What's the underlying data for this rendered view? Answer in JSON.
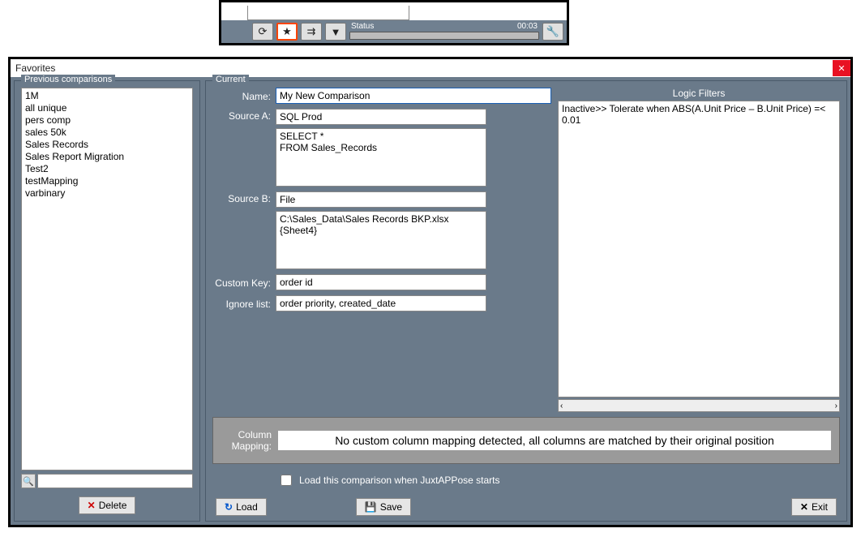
{
  "toolbar": {
    "refresh": "⟳",
    "star": "★",
    "map": "⇉",
    "filter": "▼",
    "status_label": "Status",
    "time": "00:03",
    "wrench": "🔧"
  },
  "dialog": {
    "title": "Favorites",
    "close": "✕"
  },
  "previous": {
    "group_title": "Previous comparisons",
    "items": [
      "1M",
      "all unique",
      "pers comp",
      "sales 50k",
      "Sales Records",
      "Sales Report Migration",
      "Test2",
      "testMapping",
      "varbinary"
    ],
    "search_icon": "🔍",
    "delete_icon": "✕",
    "delete_label": "Delete"
  },
  "current": {
    "group_title": "Current",
    "labels": {
      "name": "Name:",
      "sourceA": "Source A:",
      "sourceB": "Source B:",
      "customKey": "Custom Key:",
      "ignoreList": "Ignore list:",
      "columnMapping": "Column\nMapping:"
    },
    "name": "My New Comparison",
    "sourceA_conn": "SQL Prod",
    "sourceA_query": "SELECT *\nFROM Sales_Records",
    "sourceB_conn": "File",
    "sourceB_path": "C:\\Sales_Data\\Sales Records BKP.xlsx {Sheet4}",
    "customKey": "order id",
    "ignoreList": "order priority, created_date",
    "columnMappingText": "No custom column mapping detected, all columns are matched by their original position",
    "loadOnStart_label": "Load this comparison when JuxtAPPose starts",
    "loadOnStart_checked": false
  },
  "logic": {
    "header": "Logic Filters",
    "text": "Inactive>> Tolerate when ABS(A.Unit Price – B.Unit Price) =< 0.01",
    "scroll_left": "‹",
    "scroll_right": "›"
  },
  "buttons": {
    "load_icon": "↻",
    "load": "Load",
    "save_icon": "💾",
    "save": "Save",
    "exit_icon": "✕",
    "exit": "Exit"
  }
}
